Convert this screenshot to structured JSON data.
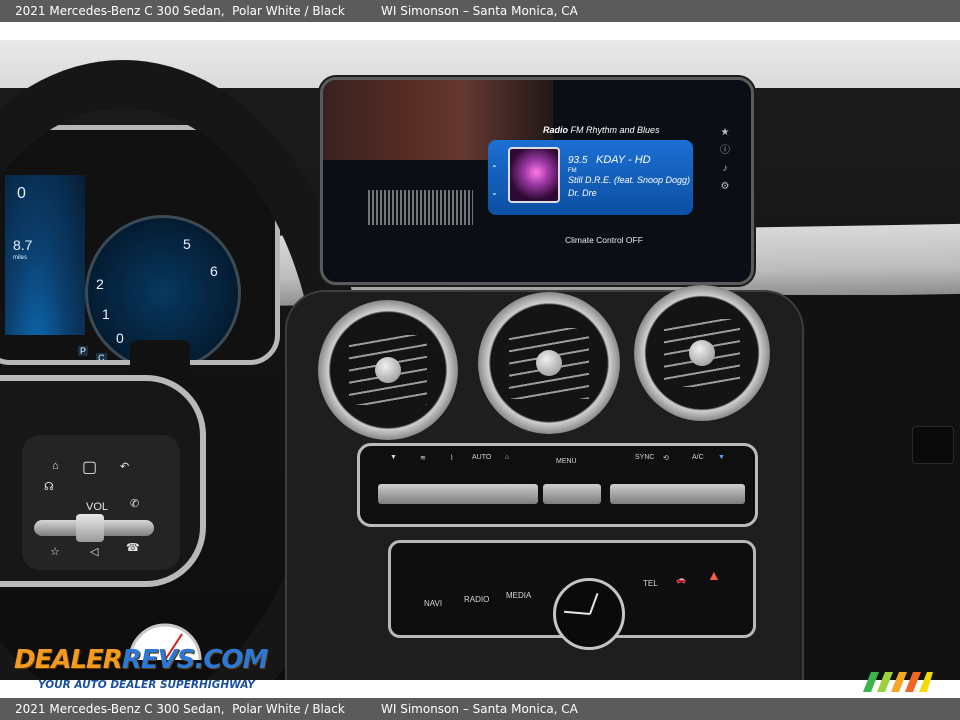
{
  "caption": {
    "vehicle": "2021 Mercedes-Benz C 300 Sedan,",
    "trim_color": "Polar White / Black",
    "dealer": "WI Simonson – Santa Monica, CA"
  },
  "infotainment": {
    "source": "Radio",
    "band_label": "FM Rhythm and Blues",
    "frequency": "93.5",
    "band": "FM",
    "station": "KDAY - HD",
    "song": "Still D.R.E. (feat. Snoop Dogg)",
    "artist": "Dr. Dre",
    "status": "Climate Control OFF",
    "side_icons": [
      "star-icon",
      "info-icon",
      "music-note-icon",
      "settings-icon"
    ]
  },
  "cluster": {
    "readout_top": "0",
    "readout_mid": "8.7",
    "readout_unit": "miles",
    "gauge_numbers": [
      "5",
      "6",
      "2",
      "1",
      "0"
    ],
    "gear_indicators": [
      "P",
      "C"
    ]
  },
  "steering_controls": {
    "vol_label": "VOL"
  },
  "climate_panel": {
    "auto_label": "AUTO",
    "menu_label": "MENU",
    "sync_label": "SYNC",
    "ac_label": "A/C"
  },
  "media_panel": {
    "navi_label": "NAVI",
    "radio_label": "RADIO",
    "media_label": "MEDIA",
    "tel_label": "TEL"
  },
  "watermark": {
    "brand_left": "DEALER",
    "brand_right": "REVS.COM",
    "tagline": "YOUR AUTO DEALER SUPERHIGHWAY"
  },
  "colors": {
    "caption_bar": "#5b5b5b",
    "radio_card": "#1b6fd3",
    "logo_orange": "#f39a1f",
    "logo_blue": "#2b78d6"
  }
}
